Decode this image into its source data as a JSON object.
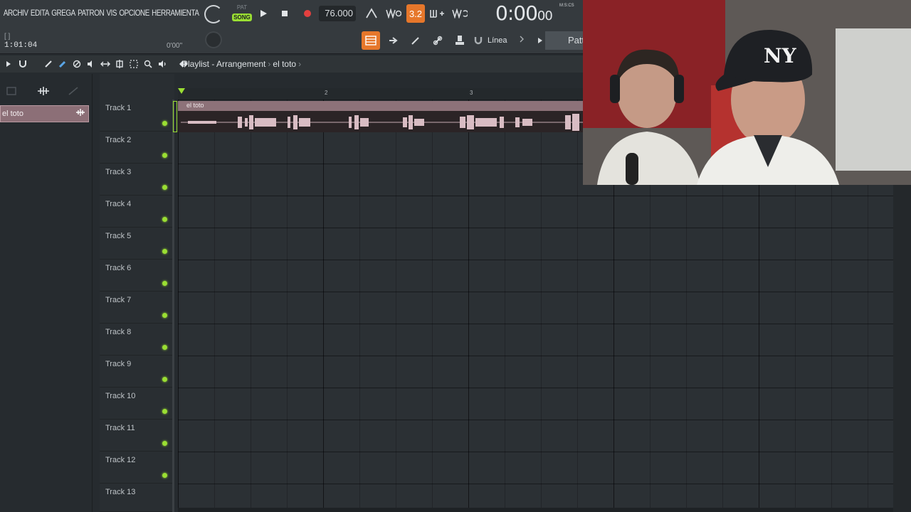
{
  "menu": [
    "ARCHIV",
    "EDITA",
    "GREGA",
    "PATRON",
    "VIS",
    "OPCIONE",
    "HERRAMIENTA"
  ],
  "transport": {
    "mode_small": "PAT",
    "mode_active": "SONG",
    "tempo": "76.000",
    "beats_label": "3.2",
    "time_main": "0:00",
    "time_sub": "00",
    "time_format": "M:S:CS",
    "hint_text": "[ ]",
    "position": "1:01:04",
    "pitch": "0'00\""
  },
  "snap": {
    "label": "Línea"
  },
  "pattern_box": "Patt",
  "playlist": {
    "title": "Playlist - Arrangement",
    "current_pattern": "el toto"
  },
  "picker": {
    "item": "el toto"
  },
  "ruler_ticks": [
    "2",
    "3"
  ],
  "clip": {
    "name": "el toto"
  },
  "tracks": [
    "Track 1",
    "Track 2",
    "Track 3",
    "Track 4",
    "Track 5",
    "Track 6",
    "Track 7",
    "Track 8",
    "Track 9",
    "Track 10",
    "Track 11",
    "Track 12",
    "Track 13"
  ],
  "colors": {
    "accent": "#e6772b",
    "led": "#9ade33",
    "clip": "#8d7279",
    "record": "#e3403f"
  }
}
